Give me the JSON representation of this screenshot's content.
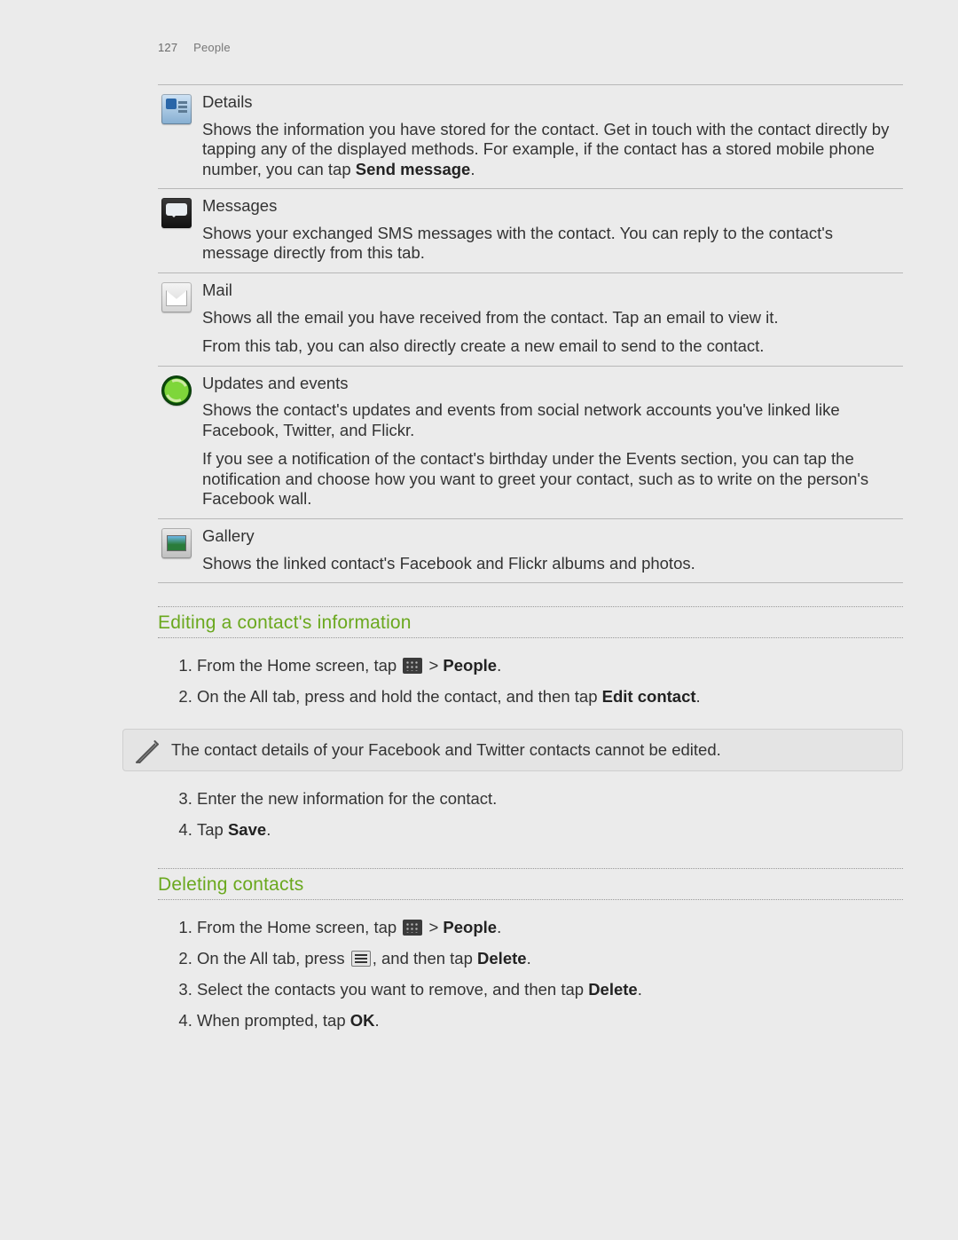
{
  "header": {
    "page_number": "127",
    "section": "People"
  },
  "tabs": [
    {
      "title": "Details",
      "paras": [
        {
          "pre": "Shows the information you have stored for the contact. Get in touch with the contact directly by tapping any of the displayed methods. For example, if the contact has a stored mobile phone number, you can tap ",
          "bold": "Send message",
          "post": "."
        }
      ]
    },
    {
      "title": "Messages",
      "paras": [
        {
          "pre": "Shows your exchanged SMS messages with the contact. You can reply to the contact's message directly from this tab.",
          "bold": "",
          "post": ""
        }
      ]
    },
    {
      "title": "Mail",
      "paras": [
        {
          "pre": "Shows all the email you have received from the contact. Tap an email to view it.",
          "bold": "",
          "post": ""
        },
        {
          "pre": "From this tab, you can also directly create a new email to send to the contact.",
          "bold": "",
          "post": ""
        }
      ]
    },
    {
      "title": "Updates and events",
      "paras": [
        {
          "pre": "Shows the contact's updates and events from social network accounts you've linked like Facebook, Twitter, and Flickr.",
          "bold": "",
          "post": ""
        },
        {
          "pre": "If you see a notification of the contact's birthday under the Events section, you can tap the notification and choose how you want to greet your contact, such as to write on the person's Facebook wall.",
          "bold": "",
          "post": ""
        }
      ]
    },
    {
      "title": "Gallery",
      "paras": [
        {
          "pre": "Shows the linked contact's Facebook and Flickr albums and photos.",
          "bold": "",
          "post": ""
        }
      ]
    }
  ],
  "sections": {
    "edit": {
      "heading": "Editing a contact's information",
      "steps": [
        {
          "pre": "From the Home screen, tap ",
          "glyph": "apps",
          "mid": " > ",
          "bold": "People",
          "post": "."
        },
        {
          "pre": "On the All tab, press and hold the contact, and then tap ",
          "glyph": "",
          "mid": "",
          "bold": "Edit contact",
          "post": "."
        }
      ],
      "note": "The contact details of your Facebook and Twitter contacts cannot be edited.",
      "steps2": [
        {
          "pre": "Enter the new information for the contact.",
          "glyph": "",
          "mid": "",
          "bold": "",
          "post": ""
        },
        {
          "pre": "Tap ",
          "glyph": "",
          "mid": "",
          "bold": "Save",
          "post": "."
        }
      ]
    },
    "delete": {
      "heading": "Deleting contacts",
      "steps": [
        {
          "pre": "From the Home screen, tap ",
          "glyph": "apps",
          "mid": " > ",
          "bold": "People",
          "post": "."
        },
        {
          "pre": "On the All tab, press ",
          "glyph": "menu",
          "mid": ", and then tap ",
          "bold": "Delete",
          "post": "."
        },
        {
          "pre": "Select the contacts you want to remove, and then tap ",
          "glyph": "",
          "mid": "",
          "bold": "Delete",
          "post": "."
        },
        {
          "pre": "When prompted, tap ",
          "glyph": "",
          "mid": "",
          "bold": "OK",
          "post": "."
        }
      ]
    }
  }
}
